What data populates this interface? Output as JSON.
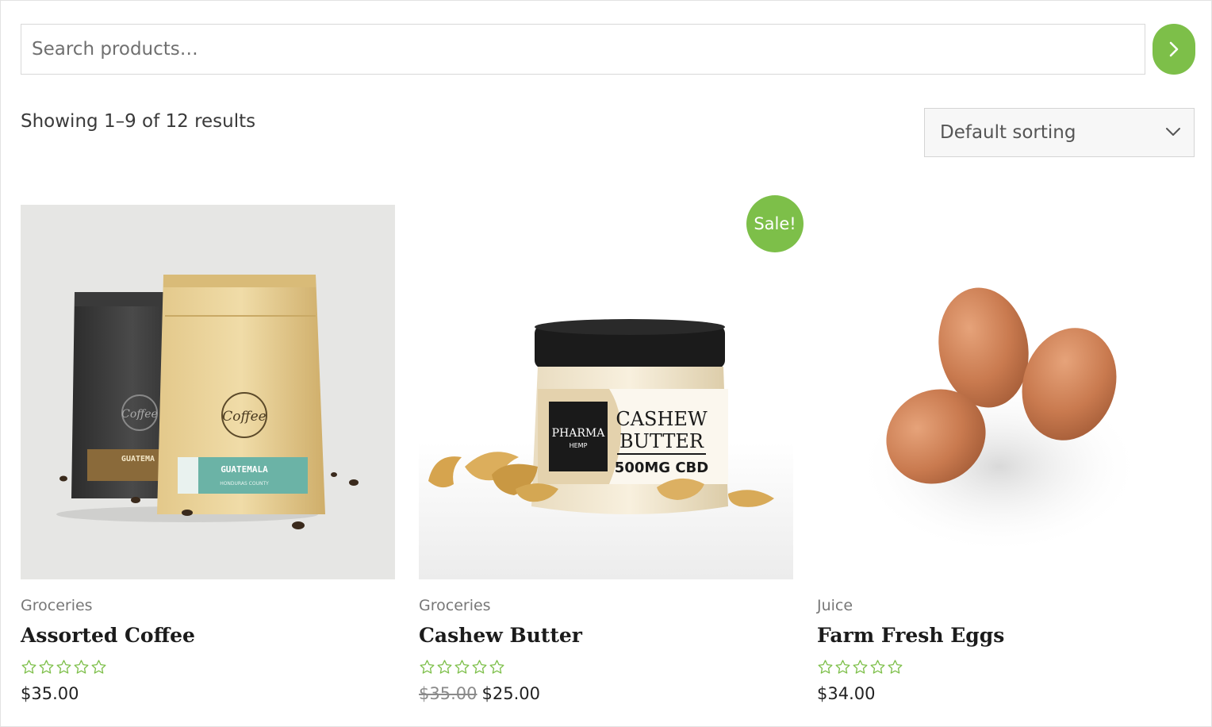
{
  "search": {
    "placeholder": "Search products…",
    "value": ""
  },
  "results": {
    "count_text": "Showing 1–9 of 12 results"
  },
  "sorting": {
    "selected": "Default sorting"
  },
  "colors": {
    "accent": "#7dbf49",
    "star": "#7dbf49"
  },
  "products": [
    {
      "image": "coffee-bags",
      "category": "Groceries",
      "name": "Assorted Coffee",
      "rating": 0,
      "price": "$35.00",
      "old_price": "",
      "on_sale": false
    },
    {
      "image": "cashew-butter-jar",
      "category": "Groceries",
      "name": "Cashew Butter",
      "rating": 0,
      "price": "$25.00",
      "old_price": "$35.00",
      "on_sale": true,
      "sale_label": "Sale!"
    },
    {
      "image": "brown-eggs",
      "category": "Juice",
      "name": "Farm Fresh Eggs",
      "rating": 0,
      "price": "$34.00",
      "old_price": "",
      "on_sale": false
    }
  ],
  "image_text": {
    "coffee_logo": "Coffee",
    "coffee_label": "GUATEMALA",
    "coffee_sublabel": "HONDURAS COUNTY",
    "coffee_label_back": "GUATEMA",
    "jar_brand": "PHARMA",
    "jar_brand_sub": "HEMP",
    "jar_line1": "CASHEW",
    "jar_line2": "BUTTER",
    "jar_line3": "500MG CBD"
  }
}
